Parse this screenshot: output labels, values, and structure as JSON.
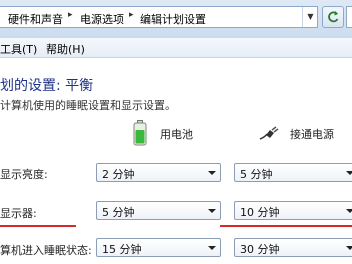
{
  "address_bar": {
    "crumbs": [
      "硬件和声音",
      "电源选项",
      "编辑计划设置"
    ],
    "separator": "▸"
  },
  "menu": {
    "items": [
      "工具(T)",
      "帮助(H)"
    ]
  },
  "plan": {
    "title": "划的设置: 平衡",
    "subtitle": "计算机使用的睡眠设置和显示设置。"
  },
  "columns": {
    "battery": "用电池",
    "plugged_in": "接通电源"
  },
  "settings": [
    {
      "label": "显示亮度:",
      "battery": "2 分钟",
      "plugged": "5 分钟"
    },
    {
      "label": "显示器:",
      "battery": "5 分钟",
      "plugged": "10 分钟"
    },
    {
      "label": "算机进入睡眠状态:",
      "battery": "15 分钟",
      "plugged": "30 分钟"
    }
  ],
  "colors": {
    "accent_title": "#1e3287",
    "highlight_line": "#d62a2a"
  }
}
